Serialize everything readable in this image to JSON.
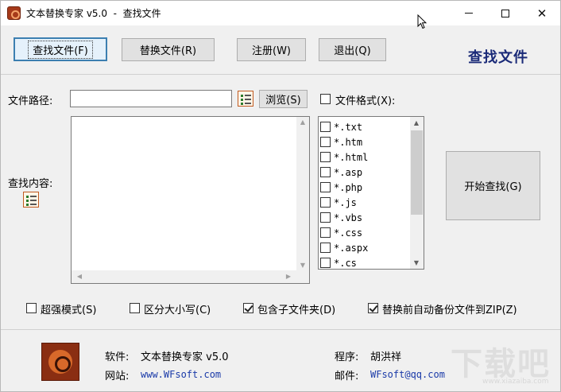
{
  "window": {
    "title": "文本替换专家 v5.0  -  查找文件",
    "controls": [
      "minimize",
      "maximize",
      "close"
    ]
  },
  "toolbar": {
    "find_label": "查找文件(F)",
    "replace_label": "替换文件(R)",
    "register_label": "注册(W)",
    "exit_label": "退出(Q)",
    "mode_title": "查找文件"
  },
  "search": {
    "path_label": "文件路径:",
    "path_value": "",
    "browse_label": "浏览(S)",
    "content_label": "查找内容:",
    "content_value": "",
    "format_label": "文件格式(X):",
    "format_checked": false,
    "start_label": "开始查找(G)"
  },
  "formats": [
    {
      "label": "*.txt",
      "checked": false
    },
    {
      "label": "*.htm",
      "checked": false
    },
    {
      "label": "*.html",
      "checked": false
    },
    {
      "label": "*.asp",
      "checked": false
    },
    {
      "label": "*.php",
      "checked": false
    },
    {
      "label": "*.js",
      "checked": false
    },
    {
      "label": "*.vbs",
      "checked": false
    },
    {
      "label": "*.css",
      "checked": false
    },
    {
      "label": "*.aspx",
      "checked": false
    },
    {
      "label": "*.cs",
      "checked": false
    }
  ],
  "options": [
    {
      "label": "超强模式(S)",
      "checked": false
    },
    {
      "label": "区分大小写(C)",
      "checked": false
    },
    {
      "label": "包含子文件夹(D)",
      "checked": true
    },
    {
      "label": "替换前自动备份文件到ZIP(Z)",
      "checked": true
    }
  ],
  "footer": {
    "software_label": "软件:",
    "software_value": "文本替换专家 v5.0",
    "website_label": "网站:",
    "website_value": "www.WFsoft.com",
    "author_label": "程序:",
    "author_value": "胡洪祥",
    "email_label": "邮件:",
    "email_value": "WFsoft@qq.com"
  },
  "watermark": {
    "text": "下载吧",
    "sub": "www.xiazaiba.com"
  },
  "colors": {
    "accent": "#1a2a78",
    "link": "#1a3aa8",
    "focus_border": "#3c7fb1"
  }
}
